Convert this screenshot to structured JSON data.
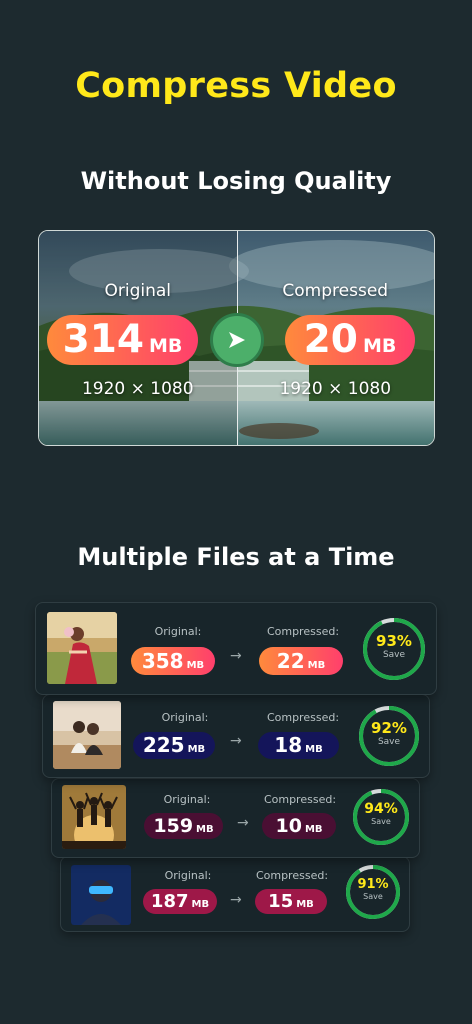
{
  "header": {
    "title": "Compress Video",
    "subtitle": "Without Losing Quality"
  },
  "hero": {
    "original_label": "Original",
    "original_size": "314",
    "original_unit": "MB",
    "original_res": "1920 × 1080",
    "compressed_label": "Compressed",
    "compressed_size": "20",
    "compressed_unit": "MB",
    "compressed_res": "1920 × 1080"
  },
  "multi": {
    "title": "Multiple Files at a Time",
    "original_label": "Original:",
    "compressed_label": "Compressed:",
    "save_label": "Save",
    "unit": "MB",
    "items": [
      {
        "original": "358",
        "compressed": "22",
        "percent": "93%",
        "ratio": 0.93
      },
      {
        "original": "225",
        "compressed": "18",
        "percent": "92%",
        "ratio": 0.92
      },
      {
        "original": "159",
        "compressed": "10",
        "percent": "94%",
        "ratio": 0.94
      },
      {
        "original": "187",
        "compressed": "15",
        "percent": "91%",
        "ratio": 0.91
      }
    ]
  },
  "colors": {
    "accent_yellow": "#ffe81a",
    "background": "#1d2a2f",
    "pill_gradient_start": "#ff8a3c",
    "pill_gradient_end": "#ff3f6c",
    "pill_navy": "#14155a",
    "pill_maroon": "#4a0f33",
    "pill_crimson": "#9e1848",
    "ring_green": "#1fa84a",
    "ring_track": "#d7dcdc"
  }
}
